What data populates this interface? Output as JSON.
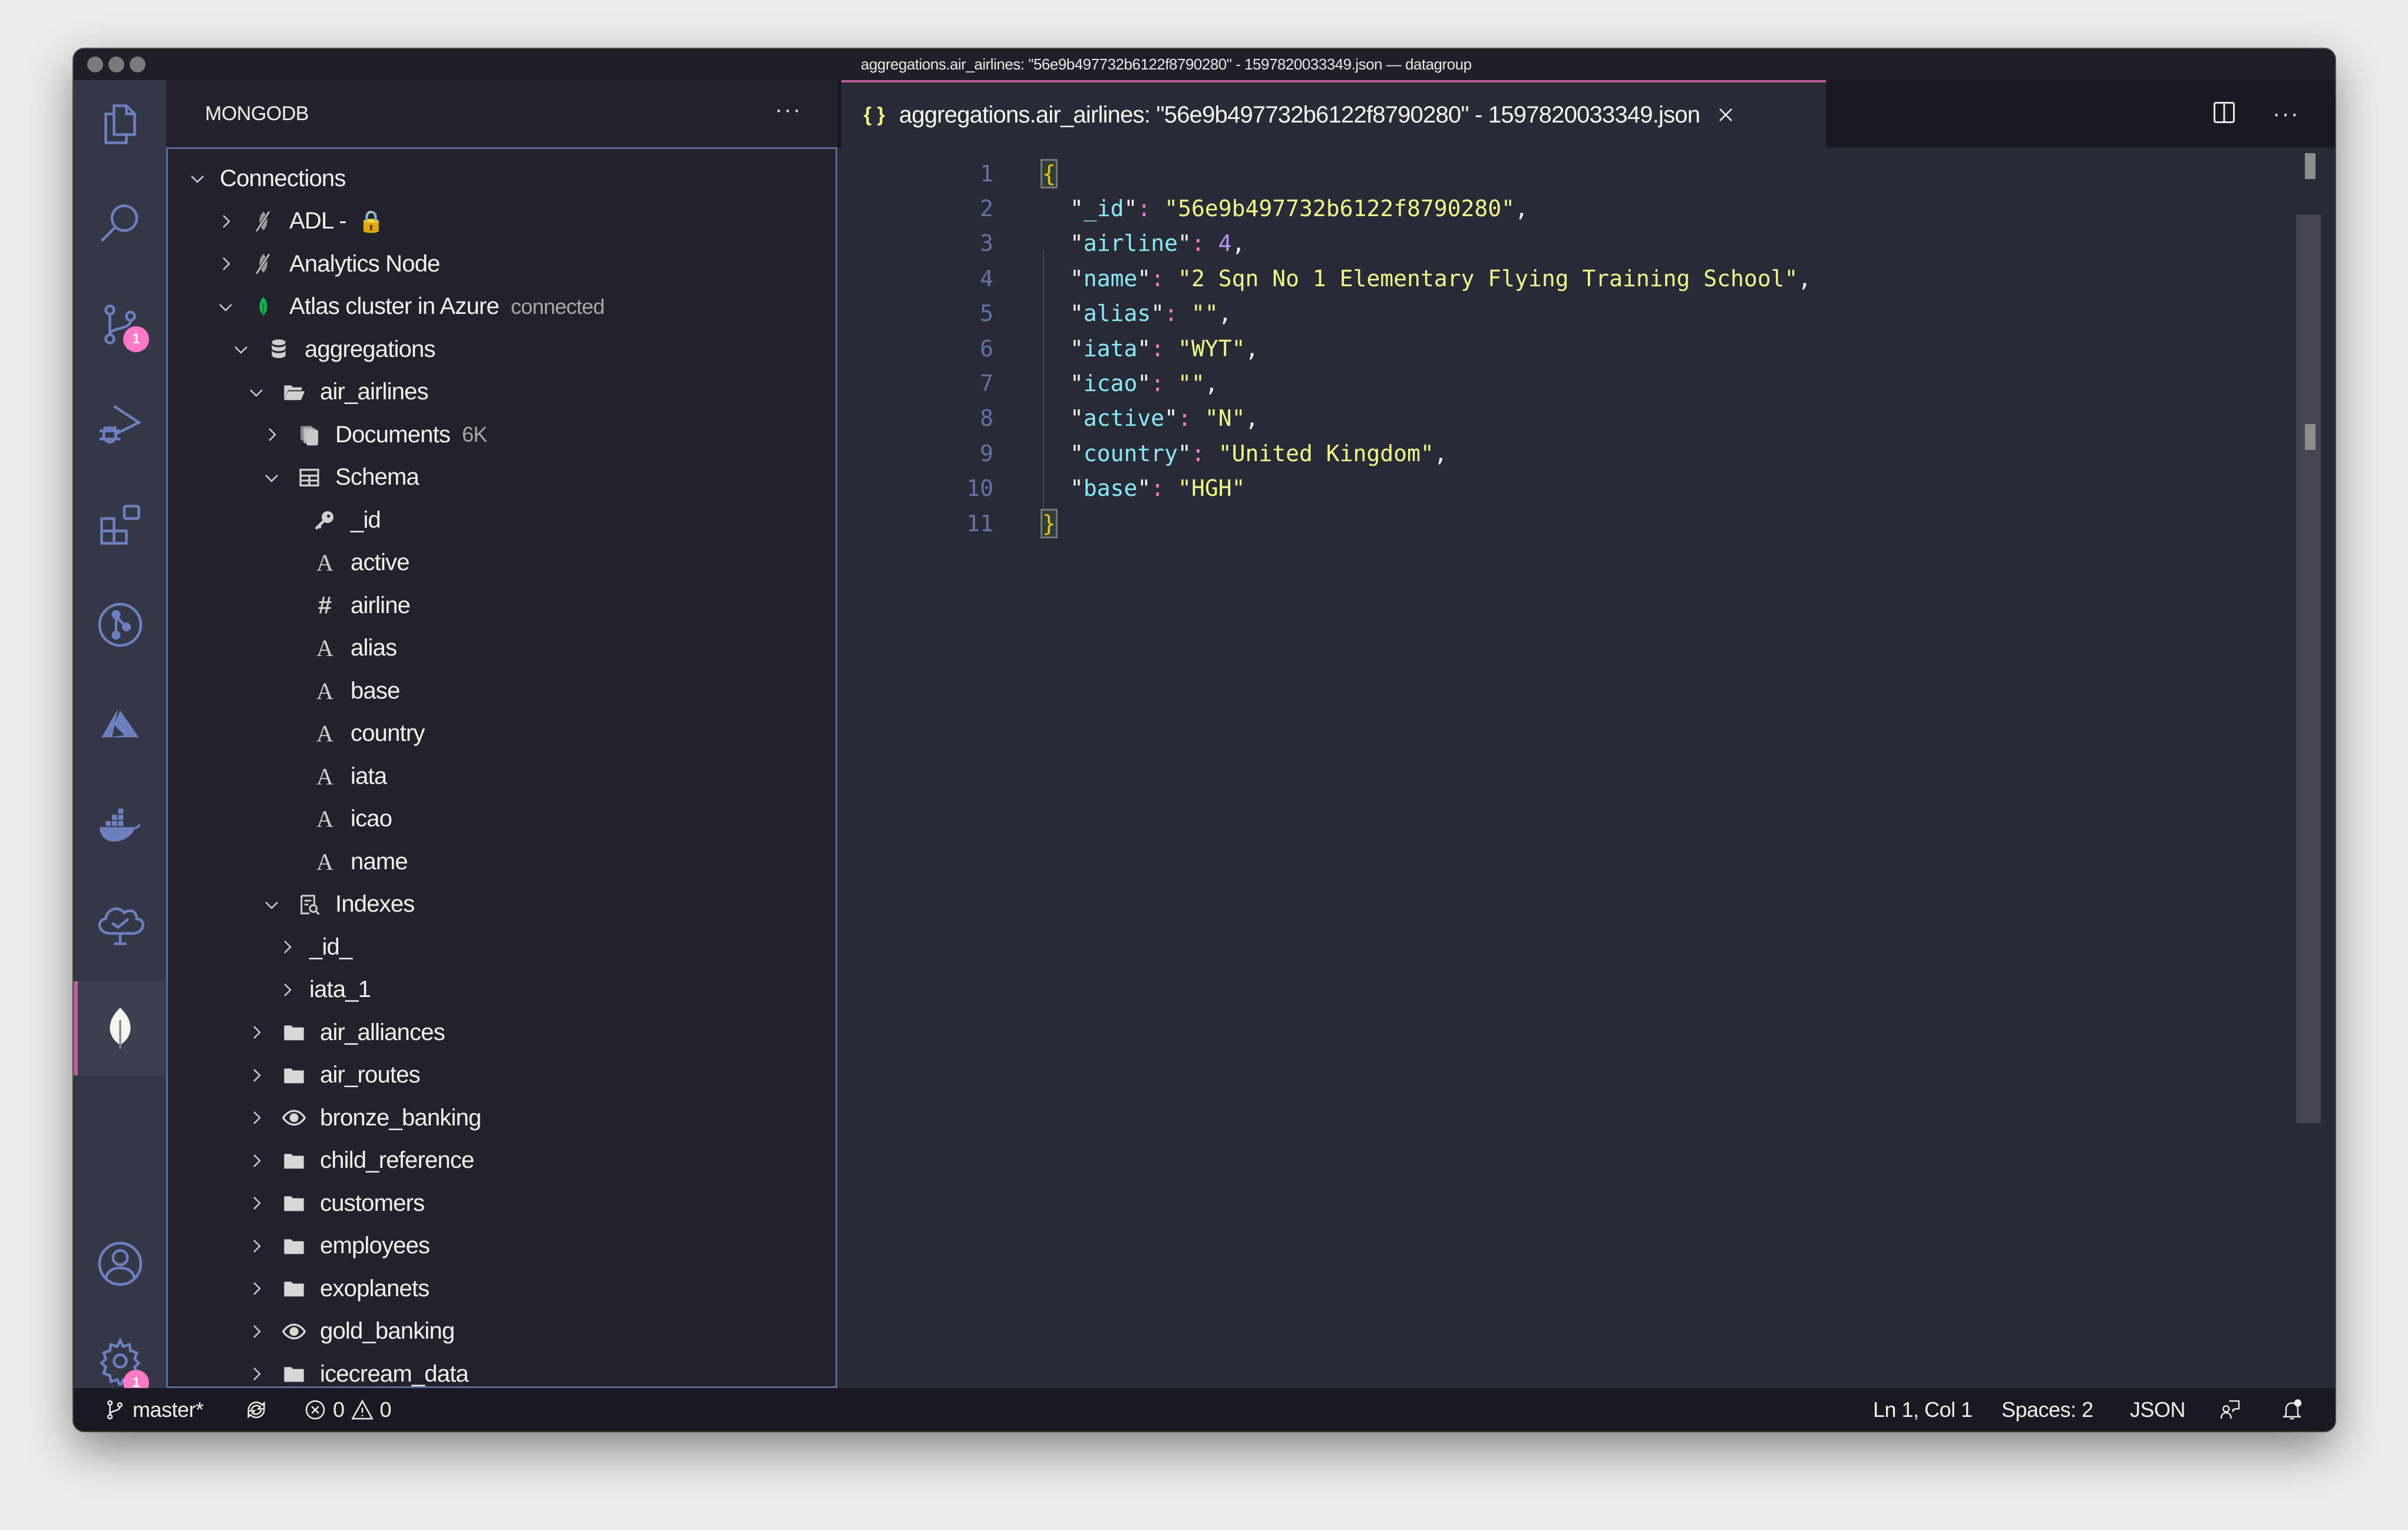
{
  "window": {
    "title": "aggregations.air_airlines: \"56e9b497732b6122f8790280\" - 1597820033349.json — datagroup"
  },
  "activity_bar": {
    "items": [
      {
        "name": "explorer",
        "icon": "files-icon"
      },
      {
        "name": "search",
        "icon": "search-icon"
      },
      {
        "name": "source-control",
        "icon": "source-control-icon",
        "badge": "1"
      },
      {
        "name": "run-debug",
        "icon": "run-debug-icon"
      },
      {
        "name": "extensions",
        "icon": "extensions-icon"
      },
      {
        "name": "gitlens",
        "icon": "git-graph-icon"
      },
      {
        "name": "azure",
        "icon": "azure-icon"
      },
      {
        "name": "docker",
        "icon": "docker-icon"
      },
      {
        "name": "tree-check",
        "icon": "tree-check-icon"
      },
      {
        "name": "mongodb",
        "icon": "mongodb-leaf-icon",
        "active": true
      }
    ],
    "bottom": [
      {
        "name": "accounts",
        "icon": "account-icon"
      },
      {
        "name": "manage",
        "icon": "gear-icon",
        "badge": "1"
      }
    ]
  },
  "sidebar": {
    "title": "MONGODB",
    "more": "···",
    "tree": {
      "connections_label": "Connections",
      "connections": [
        {
          "label": "ADL - ",
          "lock": "🔒",
          "icon": "connection-disconnected-icon",
          "expanded": false
        },
        {
          "label": "Analytics Node",
          "icon": "connection-disconnected-icon",
          "expanded": false
        },
        {
          "label": "Atlas cluster in Azure",
          "status": "connected",
          "icon": "mongodb-leaf-icon",
          "expanded": true
        }
      ],
      "database": {
        "label": "aggregations"
      },
      "collection": {
        "label": "air_airlines"
      },
      "documents": {
        "label": "Documents",
        "count": "6K"
      },
      "schema": {
        "label": "Schema",
        "fields": [
          {
            "name": "_id",
            "type": "key"
          },
          {
            "name": "active",
            "type": "A"
          },
          {
            "name": "airline",
            "type": "#"
          },
          {
            "name": "alias",
            "type": "A"
          },
          {
            "name": "base",
            "type": "A"
          },
          {
            "name": "country",
            "type": "A"
          },
          {
            "name": "iata",
            "type": "A"
          },
          {
            "name": "icao",
            "type": "A"
          },
          {
            "name": "name",
            "type": "A"
          }
        ]
      },
      "indexes": {
        "label": "Indexes",
        "items": [
          "_id_",
          "iata_1"
        ]
      },
      "collections": [
        {
          "label": "air_alliances",
          "kind": "collection"
        },
        {
          "label": "air_routes",
          "kind": "collection"
        },
        {
          "label": "bronze_banking",
          "kind": "view"
        },
        {
          "label": "child_reference",
          "kind": "collection"
        },
        {
          "label": "customers",
          "kind": "collection"
        },
        {
          "label": "employees",
          "kind": "collection"
        },
        {
          "label": "exoplanets",
          "kind": "collection"
        },
        {
          "label": "gold_banking",
          "kind": "view"
        },
        {
          "label": "icecream_data",
          "kind": "collection"
        }
      ]
    }
  },
  "editor": {
    "tab": {
      "icon": "{ }",
      "label": "aggregations.air_airlines: \"56e9b497732b6122f8790280\" - 1597820033349.json"
    },
    "lines": [
      {
        "n": "1",
        "open": "{"
      },
      {
        "n": "2",
        "key": "_id",
        "value": "\"56e9b497732b6122f8790280\"",
        "vtype": "string",
        "comma": ","
      },
      {
        "n": "3",
        "key": "airline",
        "value": "4",
        "vtype": "number",
        "comma": ","
      },
      {
        "n": "4",
        "key": "name",
        "value": "\"2 Sqn No 1 Elementary Flying Training School\"",
        "vtype": "string",
        "comma": ","
      },
      {
        "n": "5",
        "key": "alias",
        "value": "\"\"",
        "vtype": "string",
        "comma": ","
      },
      {
        "n": "6",
        "key": "iata",
        "value": "\"WYT\"",
        "vtype": "string",
        "comma": ","
      },
      {
        "n": "7",
        "key": "icao",
        "value": "\"\"",
        "vtype": "string",
        "comma": ","
      },
      {
        "n": "8",
        "key": "active",
        "value": "\"N\"",
        "vtype": "string",
        "comma": ","
      },
      {
        "n": "9",
        "key": "country",
        "value": "\"United Kingdom\"",
        "vtype": "string",
        "comma": ","
      },
      {
        "n": "10",
        "key": "base",
        "value": "\"HGH\"",
        "vtype": "string",
        "comma": ""
      },
      {
        "n": "11",
        "close": "}"
      }
    ]
  },
  "statusbar": {
    "branch": "master*",
    "errors": "0",
    "warnings": "0",
    "position": "Ln 1, Col 1",
    "indent": "Spaces: 2",
    "language": "JSON"
  },
  "colors": {
    "accent": "#bd5f9b",
    "badge": "#ff79c6",
    "key": "#8be9fd",
    "string": "#f1fa8c",
    "number": "#bd93f9",
    "line_number": "#6272a4",
    "connected_leaf": "#13aa52"
  }
}
